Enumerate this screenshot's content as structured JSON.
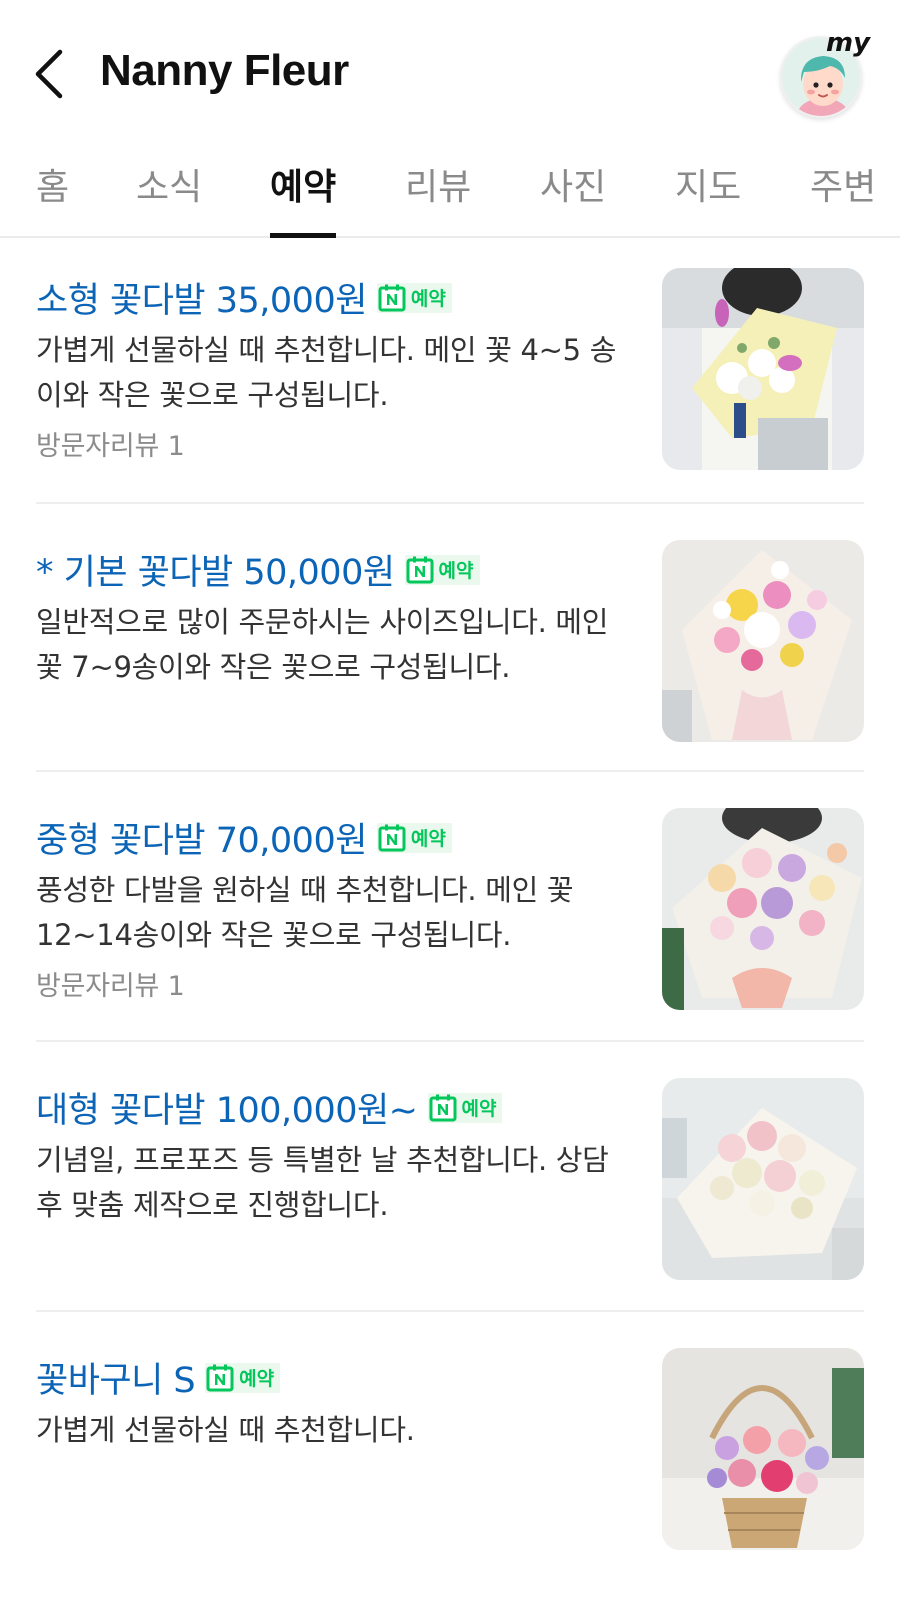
{
  "header": {
    "title": "Nanny Fleur",
    "my_label": "my"
  },
  "tabs": [
    {
      "label": "홈",
      "active": false
    },
    {
      "label": "소식",
      "active": false
    },
    {
      "label": "예약",
      "active": true
    },
    {
      "label": "리뷰",
      "active": false
    },
    {
      "label": "사진",
      "active": false
    },
    {
      "label": "지도",
      "active": false
    },
    {
      "label": "주변",
      "active": false
    }
  ],
  "badge_label": "예약",
  "items": [
    {
      "title": "소형 꽃다발 35,000원",
      "desc": "가볍게 선물하실 때 추천합니다. 메인 꽃 4~5 송이와 작은 꽃으로 구성됩니다.",
      "review": "방문자리뷰 1"
    },
    {
      "title": "* 기본 꽃다발 50,000원",
      "desc": "일반적으로 많이 주문하시는 사이즈입니다. 메인 꽃 7~9송이와 작은 꽃으로 구성됩니다.",
      "review": ""
    },
    {
      "title": "중형 꽃다발 70,000원",
      "desc": "풍성한 다발을 원하실 때 추천합니다. 메인 꽃 12~14송이와 작은 꽃으로 구성됩니다.",
      "review": "방문자리뷰 1"
    },
    {
      "title": "대형 꽃다발 100,000원~",
      "desc": "기념일, 프로포즈 등 특별한 날 추천합니다. 상담 후 맞춤 제작으로 진행합니다.",
      "review": ""
    },
    {
      "title": "꽃바구니 S",
      "desc": "가볍게 선물하실 때 추천합니다.",
      "review": ""
    }
  ],
  "colors": {
    "title_blue": "#0c64b7",
    "naver_green": "#03c75a",
    "badge_bg": "#eaf8ee"
  }
}
